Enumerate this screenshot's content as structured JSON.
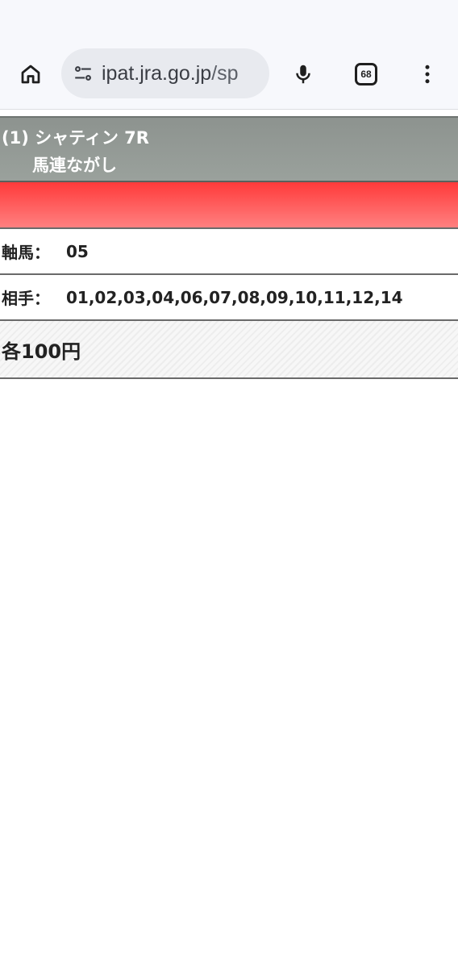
{
  "browser": {
    "url_host": "ipat.jra.go.jp",
    "url_path": "/sp",
    "tab_count": "68",
    "icons": {
      "home": "home-icon",
      "site_settings": "tune-icon",
      "mic": "mic-icon",
      "tabs": "tabs-icon",
      "menu": "more-vert-icon"
    }
  },
  "bet": {
    "race_line": "(1) シャティン 7R",
    "bet_type": "馬連ながし",
    "axis_label": "軸馬：",
    "axis_value": "05",
    "partners_label": "相手：",
    "partners_value": "01,02,03,04,06,07,08,09,10,11,12,14",
    "amount": "各100円"
  },
  "colors": {
    "header_bg": "#939a95",
    "red_bar_top": "#ff3a3a",
    "red_bar_bottom": "#ff8080"
  }
}
